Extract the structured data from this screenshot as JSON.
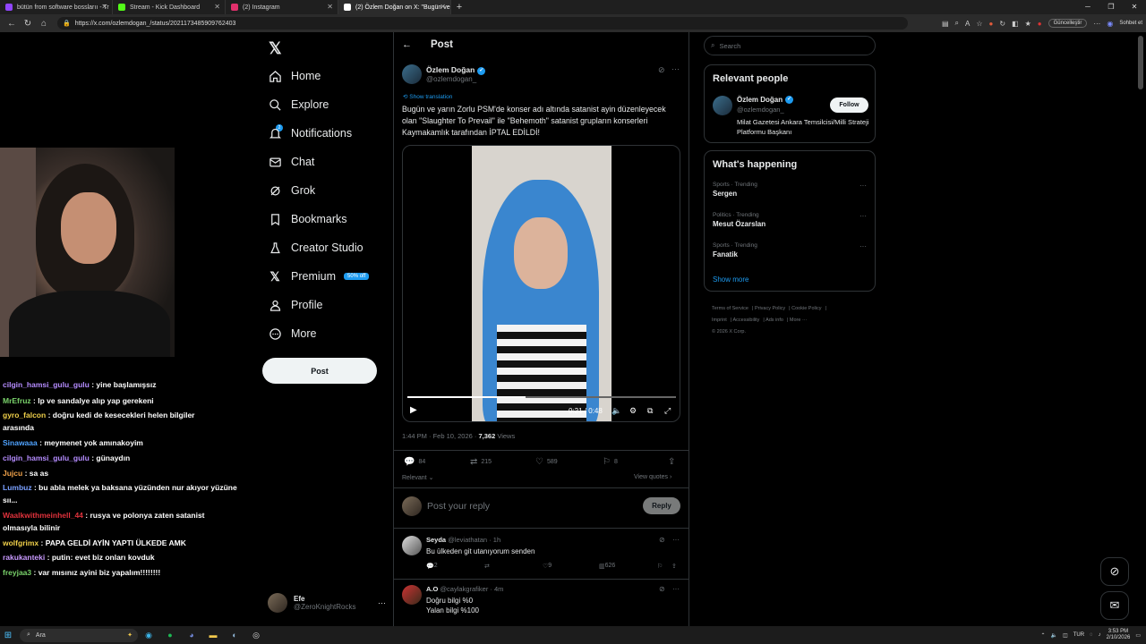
{
  "browser": {
    "tabs": [
      {
        "title": "bütün from software bosslarıı - Tr",
        "color": "#9146ff"
      },
      {
        "title": "Stream - Kick Dashboard",
        "color": "#53fc18"
      },
      {
        "title": "(2) Instagram",
        "color": "#e1306c"
      },
      {
        "title": "(2) Özlem Doğan on X: \"Bugün ve",
        "color": "#ffffff"
      }
    ],
    "url": "https://x.com/ozlemdogan_/status/2021173485909762403",
    "update_label": "Güncelleştir",
    "chat_label": "Sohbet et"
  },
  "nav": {
    "items": [
      {
        "label": "Home",
        "icon": "home-icon"
      },
      {
        "label": "Explore",
        "icon": "search-icon"
      },
      {
        "label": "Notifications",
        "icon": "bell-icon"
      },
      {
        "label": "Chat",
        "icon": "mail-icon"
      },
      {
        "label": "Grok",
        "icon": "grok-icon"
      },
      {
        "label": "Bookmarks",
        "icon": "bookmark-icon"
      },
      {
        "label": "Creator Studio",
        "icon": "flask-icon"
      },
      {
        "label": "Premium",
        "icon": "x-icon"
      },
      {
        "label": "Profile",
        "icon": "person-icon"
      },
      {
        "label": "More",
        "icon": "more-icon"
      }
    ],
    "notif_count": "2",
    "premium_badge": "50% off",
    "post_label": "Post",
    "account": {
      "name": "Efe",
      "handle": "@ZeroKnightRocks"
    }
  },
  "chat": [
    {
      "user": "cilgin_hamsi_gulu_gulu",
      "color": "#b58cff",
      "text": ": yine başlamışsız"
    },
    {
      "user": "MrEfruz",
      "color": "#7ad36b",
      "text": ": Ip ve sandalye alıp yap gerekeni"
    },
    {
      "user": "gyro_falcon",
      "color": "#f0d04a",
      "text": ": doğru kedi de kesecekleri helen bilgiler arasında"
    },
    {
      "user": "Sinawaaa",
      "color": "#4fa3ff",
      "text": ": meymenet yok amınakoyim"
    },
    {
      "user": "cilgin_hamsi_gulu_gulu",
      "color": "#b58cff",
      "text": ": günaydın"
    },
    {
      "user": "Jujcu",
      "color": "#f0a24a",
      "text": ": sa as"
    },
    {
      "user": "Lumbuz",
      "color": "#7aa0ff",
      "text": ": bu abla melek ya baksana yüzünden nur akıyor yüzüne sıı..."
    },
    {
      "user": "Waalkwithmeinhell_44",
      "color": "#e0323c",
      "text": ": rusya ve polonya zaten satanist olmasıyla bilinir"
    },
    {
      "user": "wolfgrimx",
      "color": "#f0d04a",
      "text": ": PAPA GELDİ AYİN YAPTI ÜLKEDE AMK"
    },
    {
      "user": "rakukanteki",
      "color": "#c99aff",
      "text": ": putin: evet biz onları kovduk"
    },
    {
      "user": "freyjaa3",
      "color": "#7ad36b",
      "text": ": var mısınız ayini biz yapalım!!!!!!!!"
    }
  ],
  "post": {
    "header": "Post",
    "author_name": "Özlem Doğan",
    "author_handle": "@ozlemdogan_",
    "show_translation": "Show translation",
    "text": "Bugün ve yarın Zorlu PSM'de konser adı altında satanist ayin düzenleyecek olan \"Slaughter To Prevail\" ile \"Behemoth\" satanist grupların konserleri Kaymakamlık tarafından İPTAL EDİLDİ!",
    "video_time": "0:21 / 0:48",
    "video_progress": 0.44,
    "timestamp": "1:44 PM · Feb 10, 2026 · ",
    "views_count": "7,362",
    "views_label": " Views",
    "stats": {
      "replies": "84",
      "reposts": "215",
      "likes": "589",
      "bookmarks": "8"
    },
    "relevant_label": "Relevant",
    "view_quotes": "View quotes",
    "reply_placeholder": "Post your reply",
    "reply_button": "Reply"
  },
  "replies": [
    {
      "name": "Seyda",
      "handle": "@leviathatan",
      "time": "· 1h",
      "text": "Bu ülkeden git utanıyorum senden",
      "replies": "2",
      "reposts": "",
      "likes": "9",
      "views": "626"
    },
    {
      "name": "A.O",
      "handle": "@caylakgrafiker",
      "time": "· 4m",
      "text_line1": "Doğru bilgi %0",
      "text_line2": "Yalan bilgi %100"
    }
  ],
  "sidebar": {
    "search_placeholder": "Search",
    "relevant_title": "Relevant people",
    "person": {
      "name": "Özlem Doğan",
      "handle": "@ozlemdogan_",
      "bio": "Milat Gazetesi Ankara Temsilcisi/Milli Strateji Platformu Başkanı",
      "follow": "Follow"
    },
    "happening_title": "What's happening",
    "trends": [
      {
        "category": "Sports · Trending",
        "name": "Sergen"
      },
      {
        "category": "Politics · Trending",
        "name": "Mesut Özarslan"
      },
      {
        "category": "Sports · Trending",
        "name": "Fanatik"
      }
    ],
    "show_more": "Show more",
    "footer": [
      "Terms of Service",
      "Privacy Policy",
      "Cookie Policy",
      "Imprint",
      "Accessibility",
      "Ads info",
      "More ···",
      "© 2026 X Corp."
    ]
  },
  "taskbar": {
    "search_label": "Ara",
    "lang": "TUR",
    "time": "3:53 PM",
    "date": "2/10/2026"
  }
}
